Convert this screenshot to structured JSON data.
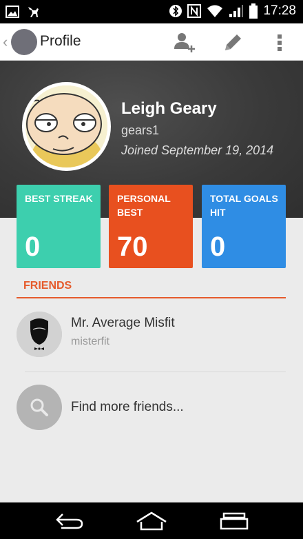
{
  "status_bar": {
    "time": "17:28"
  },
  "action_bar": {
    "title": "Profile"
  },
  "profile": {
    "name": "Leigh Geary",
    "handle": "gears1",
    "joined": "Joined September 19, 2014"
  },
  "stats": [
    {
      "label": "Best Streak",
      "value": "0",
      "color": "#3dcfae"
    },
    {
      "label": "Personal Best",
      "value": "70",
      "color": "#e8501f"
    },
    {
      "label": "Total Goals Hit",
      "value": "0",
      "color": "#2f8de4"
    }
  ],
  "friends": {
    "title": "FRIENDS",
    "items": [
      {
        "name": "Mr. Average Misfit",
        "handle": "misterfit"
      }
    ],
    "find_label": "Find more friends..."
  },
  "icons": {
    "add_friend": "add-user-icon",
    "edit": "pencil-icon",
    "overflow": "more-vertical-icon",
    "search": "search-icon"
  },
  "colors": {
    "accent": "#e55a2b",
    "header_bg": "#3a3a3a"
  }
}
